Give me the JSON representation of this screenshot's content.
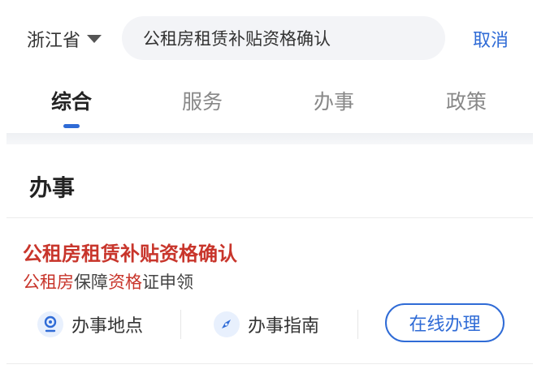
{
  "header": {
    "region": "浙江省",
    "search_value": "公租房租赁补贴资格确认",
    "cancel_label": "取消"
  },
  "tabs": [
    {
      "label": "综合",
      "active": true
    },
    {
      "label": "服务",
      "active": false
    },
    {
      "label": "办事",
      "active": false
    },
    {
      "label": "政策",
      "active": false
    }
  ],
  "section": {
    "title": "办事"
  },
  "result": {
    "title": "公租房租赁补贴资格确认",
    "subtitle_parts": [
      {
        "text": "公租房",
        "highlight": true
      },
      {
        "text": "保障",
        "highlight": false
      },
      {
        "text": "资格",
        "highlight": true
      },
      {
        "text": "证申领",
        "highlight": false
      }
    ],
    "actions": {
      "location_label": "办事地点",
      "guide_label": "办事指南",
      "online_label": "在线办理"
    }
  },
  "colors": {
    "accent": "#2f6bd6",
    "highlight": "#c8352b"
  }
}
